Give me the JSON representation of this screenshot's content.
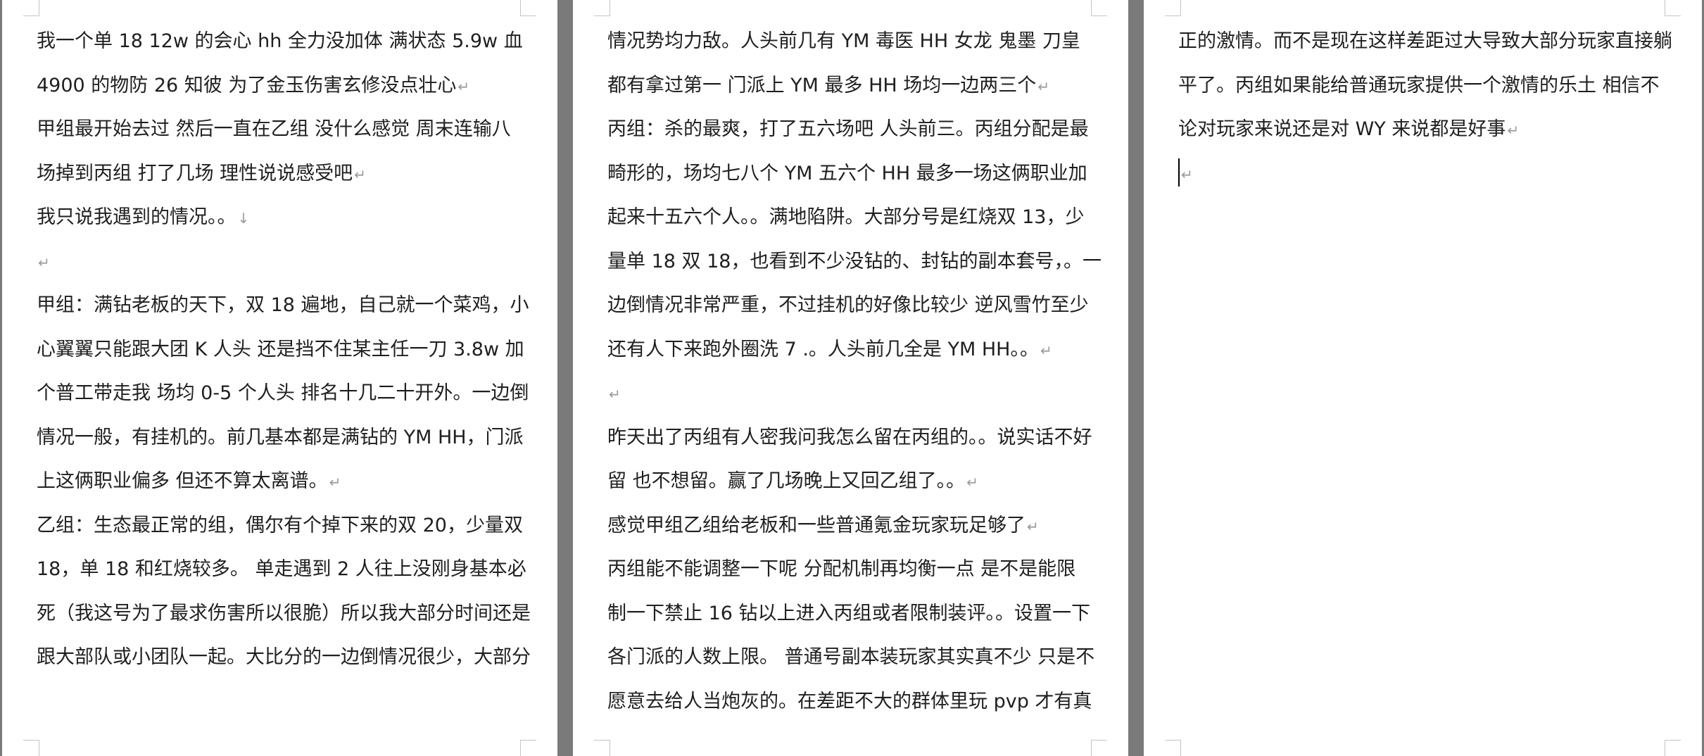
{
  "pages": [
    {
      "lines": [
        {
          "text": "我一个单 18 12w 的会心 hh   全力没加体  满状态 5.9w 血",
          "mark": ""
        },
        {
          "text": "4900 的物防  26 知彼  为了金玉伤害玄修没点壮心",
          "mark": "↵"
        },
        {
          "text": "甲组最开始去过  然后一直在乙组  没什么感觉  周末连输八",
          "mark": ""
        },
        {
          "text": "场掉到丙组  打了几场  理性说说感受吧",
          "mark": "↵"
        },
        {
          "text": "我只说我遇到的情况。。",
          "mark": "↓"
        },
        {
          "text": "",
          "mark": "↵"
        },
        {
          "text": "甲组：满钻老板的天下，双 18 遍地，自己就一个菜鸡，小",
          "mark": ""
        },
        {
          "text": "心翼翼只能跟大团 K 人头  还是挡不住某主任一刀 3.8w 加",
          "mark": ""
        },
        {
          "text": "个普工带走我  场均 0-5 个人头  排名十几二十开外。一边倒",
          "mark": ""
        },
        {
          "text": "情况一般，有挂机的。前几基本都是满钻的 YM HH，门派",
          "mark": ""
        },
        {
          "text": "上这俩职业偏多  但还不算太离谱。",
          "mark": "↵"
        },
        {
          "text": "乙组：生态最正常的组，偶尔有个掉下来的双 20，少量双",
          "mark": ""
        },
        {
          "text": "18，单 18 和红烧较多。  单走遇到 2 人往上没刚身基本必",
          "mark": ""
        },
        {
          "text": "死（我这号为了最求伤害所以很脆）所以我大部分时间还是",
          "mark": ""
        },
        {
          "text": "跟大部队或小团队一起。大比分的一边倒情况很少，大部分",
          "mark": ""
        }
      ]
    },
    {
      "lines": [
        {
          "text": "情况势均力敌。人头前几有 YM  毒医  HH  女龙  鬼墨  刀皇",
          "mark": ""
        },
        {
          "text": "都有拿过第一  门派上 YM 最多  HH 场均一边两三个",
          "mark": "↵"
        },
        {
          "text": "丙组：杀的最爽，打了五六场吧  人头前三。丙组分配是最",
          "mark": ""
        },
        {
          "text": "畸形的，场均七八个 YM  五六个 HH  最多一场这俩职业加",
          "mark": ""
        },
        {
          "text": "起来十五六个人。。满地陷阱。大部分号是红烧双 13，少",
          "mark": ""
        },
        {
          "text": "量单 18 双 18，也看到不少没钻的、封钻的副本套号，。一",
          "mark": ""
        },
        {
          "text": "边倒情况非常严重，不过挂机的好像比较少  逆风雪竹至少",
          "mark": ""
        },
        {
          "text": "还有人下来跑外圈洗 7 .。人头前几全是 YM HH。。",
          "mark": "↵"
        },
        {
          "text": "",
          "mark": "↵"
        },
        {
          "text": "昨天出了丙组有人密我问我怎么留在丙组的。。说实话不好",
          "mark": ""
        },
        {
          "text": "留  也不想留。赢了几场晚上又回乙组了。。",
          "mark": "↵"
        },
        {
          "text": "感觉甲组乙组给老板和一些普通氪金玩家玩足够了",
          "mark": "↵"
        },
        {
          "text": "丙组能不能调整一下呢   分配机制再均衡一点  是不是能限",
          "mark": ""
        },
        {
          "text": "制一下禁止 16 钻以上进入丙组或者限制装评。。设置一下",
          "mark": ""
        },
        {
          "text": "各门派的人数上限。   普通号副本装玩家其实真不少  只是不",
          "mark": ""
        },
        {
          "text": "愿意去给人当炮灰的。在差距不大的群体里玩 pvp 才有真",
          "mark": ""
        }
      ]
    },
    {
      "lines": [
        {
          "text": "正的激情。而不是现在这样差距过大导致大部分玩家直接躺",
          "mark": ""
        },
        {
          "text": "平了。丙组如果能给普通玩家提供一个激情的乐土  相信不",
          "mark": ""
        },
        {
          "text": "论对玩家来说还是对 WY 来说都是好事",
          "mark": "↵"
        },
        {
          "text": "",
          "mark": "↵"
        }
      ]
    }
  ]
}
